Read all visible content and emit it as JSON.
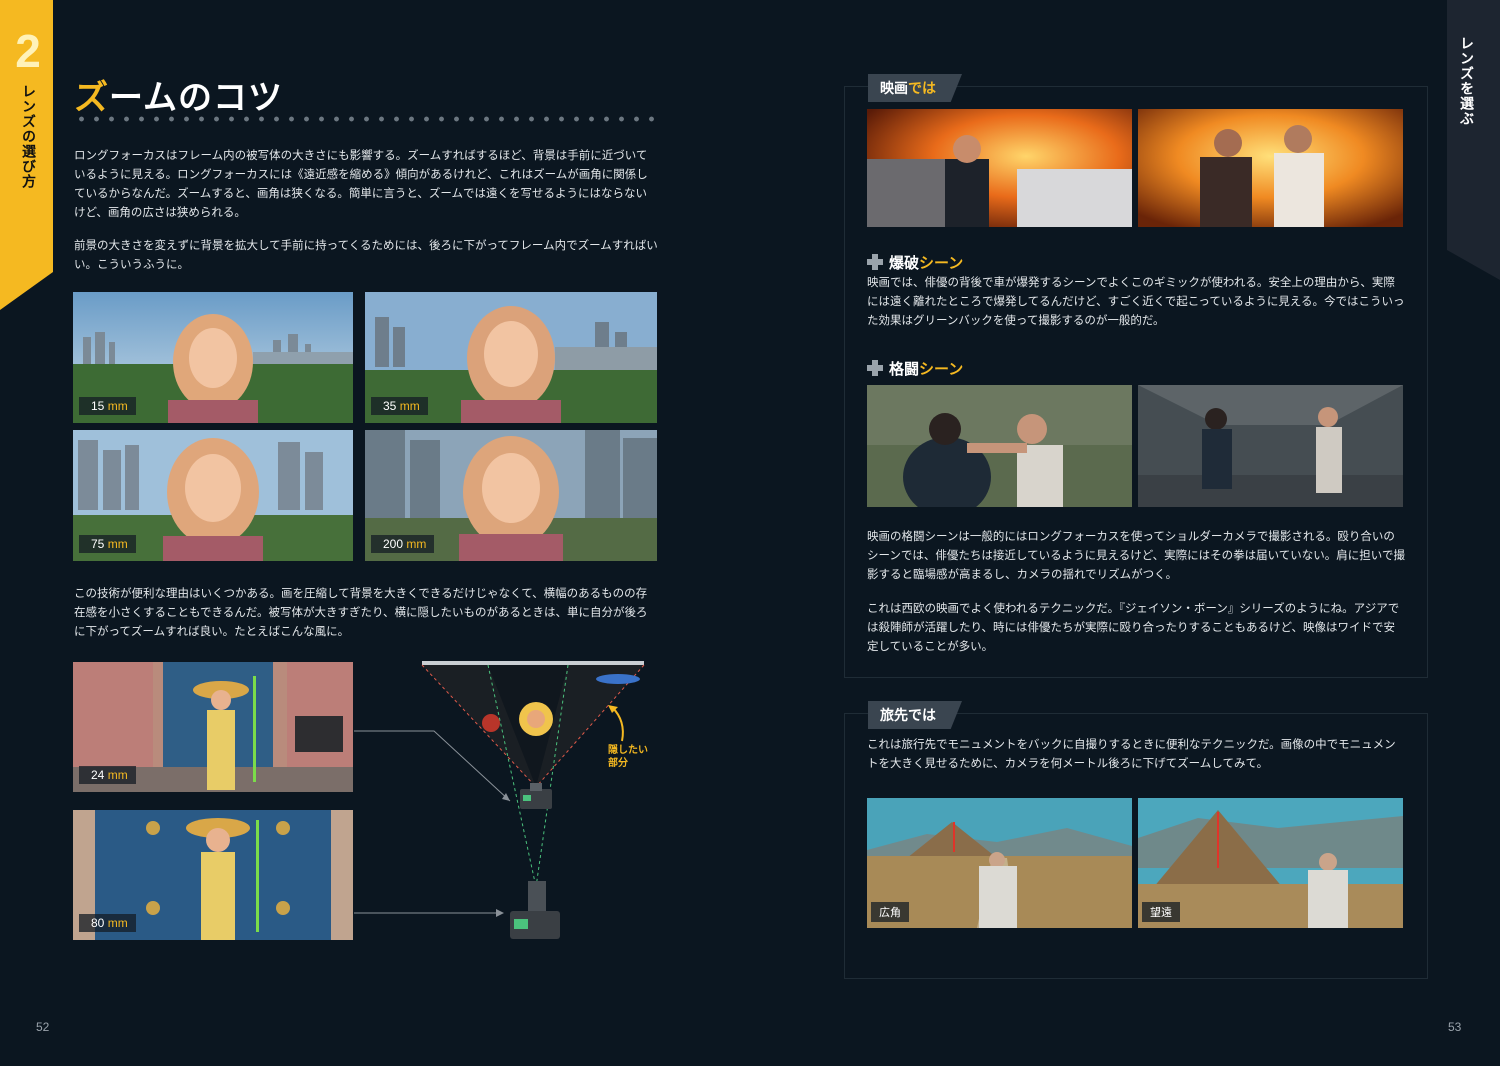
{
  "left_page": {
    "chapter_number": "2",
    "chapter_label": "レンズの選び方",
    "title_accent": "ズ",
    "title_rest": "ームのコツ",
    "paragraph1": "ロングフォーカスはフレーム内の被写体の大きさにも影響する。ズームすればするほど、背景は手前に近づいているように見える。ロングフォーカスには《遠近感を縮める》傾向があるけれど、これはズームが画角に関係しているからなんだ。ズームすると、画角は狭くなる。簡単に言うと、ズームでは遠くを写せるようにはならないけど、画角の広さは狭められる。",
    "paragraph2": "前景の大きさを変えずに背景を拡大して手前に持ってくるためには、後ろに下がってフレーム内でズームすればいい。こういうふうに。",
    "focal_grid": [
      {
        "num": "15",
        "unit": "mm"
      },
      {
        "num": "35",
        "unit": "mm"
      },
      {
        "num": "75",
        "unit": "mm"
      },
      {
        "num": "200",
        "unit": "mm"
      }
    ],
    "paragraph3": "この技術が便利な理由はいくつかある。画を圧縮して背景を大きくできるだけじゃなくて、横幅のあるものの存在感を小さくすることもできるんだ。被写体が大きすぎたり、横に隠したいものがあるときは、単に自分が後ろに下がってズームすれば良い。たとえばこんな風に。",
    "example_24": {
      "num": "24",
      "unit": "mm"
    },
    "example_80": {
      "num": "80",
      "unit": "mm"
    },
    "hidden_label_line1": "隠したい",
    "hidden_label_line2": "部分",
    "page_number": "52"
  },
  "right_page": {
    "tab_label": "レンズを選ぶ",
    "section_movie": {
      "tag_main": "映画",
      "tag_accent": "では"
    },
    "explosion": {
      "head_main": "爆破",
      "head_accent": "シーン",
      "text": "映画では、俳優の背後で車が爆発するシーンでよくこのギミックが使われる。安全上の理由から、実際には遠く離れたところで爆発してるんだけど、すごく近くで起こっているように見える。今ではこういった効果はグリーンバックを使って撮影するのが一般的だ。"
    },
    "fight": {
      "head_main": "格闘",
      "head_accent": "シーン",
      "text1": "映画の格闘シーンは一般的にはロングフォーカスを使ってショルダーカメラで撮影される。殴り合いのシーンでは、俳優たちは接近しているように見えるけど、実際にはその拳は届いていない。肩に担いで撮影すると臨場感が高まるし、カメラの揺れでリズムがつく。",
      "text2": "これは西欧の映画でよく使われるテクニックだ。『ジェイソン・ボーン』シリーズのようにね。アジアでは殺陣師が活躍したり、時には俳優たちが実際に殴り合ったりすることもあるけど、映像はワイドで安定していることが多い。"
    },
    "travel": {
      "tag": "旅先では",
      "text": "これは旅行先でモニュメントをバックに自撮りするときに便利なテクニックだ。画像の中でモニュメントを大きく見せるために、カメラを何メートル後ろに下げてズームしてみて。",
      "label_wide": "広角",
      "label_tele": "望遠"
    },
    "page_number": "53"
  },
  "colors": {
    "accent": "#f5b921",
    "background": "#0b1620",
    "box_border": "#1f2c36",
    "tag_bg": "#3a4550"
  }
}
